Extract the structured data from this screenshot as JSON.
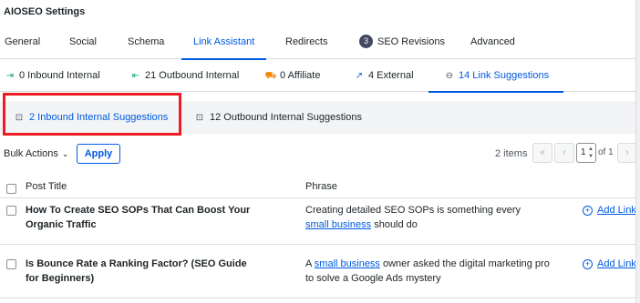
{
  "header": {
    "title": "AIOSEO Settings"
  },
  "main_tabs": [
    {
      "label": "General"
    },
    {
      "label": "Social"
    },
    {
      "label": "Schema"
    },
    {
      "label": "Link Assistant"
    },
    {
      "label": "Redirects"
    },
    {
      "label": "SEO Revisions",
      "badge": "3"
    },
    {
      "label": "Advanced"
    }
  ],
  "active_main_tab": "Link Assistant",
  "sub_tabs": [
    {
      "label": "0 Inbound Internal",
      "icon": "inbound-icon"
    },
    {
      "label": "21 Outbound Internal",
      "icon": "outbound-icon"
    },
    {
      "label": "0 Affiliate",
      "icon": "affiliate-cart-icon"
    },
    {
      "label": "4 External",
      "icon": "external-link-icon"
    },
    {
      "label": "14 Link Suggestions",
      "icon": "chain-link-icon"
    }
  ],
  "active_sub_tab": "14 Link Suggestions",
  "suggestion_tabs": [
    {
      "label": "2 Inbound Internal Suggestions",
      "icon": "inbound-icon"
    },
    {
      "label": "12 Outbound Internal Suggestions",
      "icon": "outbound-icon"
    }
  ],
  "active_suggestion_tab": "2 Inbound Internal Suggestions",
  "toolbar": {
    "bulk_actions_label": "Bulk Actions",
    "apply_label": "Apply",
    "items_count": "2 items"
  },
  "pagination": {
    "first": "«",
    "prev": "‹",
    "current_page": "1",
    "of_label": "of 1",
    "next": "›"
  },
  "table": {
    "headers": {
      "post_title": "Post Title",
      "phrase": "Phrase"
    },
    "rows": [
      {
        "title": "How To Create SEO SOPs That Can Boost Your Organic Traffic",
        "phrase_before": "Creating detailed SEO SOPs is something every",
        "phrase_link": "small business",
        "phrase_after": "should do",
        "action_label": "Add Link"
      },
      {
        "title": "Is Bounce Rate a Ranking Factor? (SEO Guide for Beginners)",
        "phrase_before": "A",
        "phrase_link": "small business",
        "phrase_after": "owner asked the digital marketing pro to solve a Google Ads mystery",
        "action_label": "Add Link"
      }
    ]
  },
  "colors": {
    "accent": "#005ae0",
    "highlight_border": "#ee1c24",
    "text": "#1d2327",
    "border": "#dcdcde"
  }
}
